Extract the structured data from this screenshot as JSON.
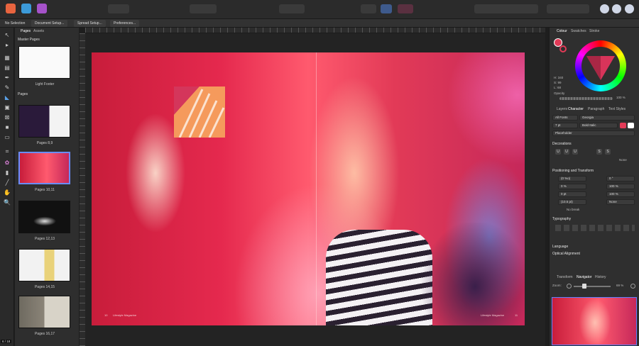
{
  "context_bar": {
    "items": [
      "No Selection",
      "Document Setup...",
      "Spread Setup...",
      "Preferences..."
    ]
  },
  "pages_panel": {
    "tabs": [
      "Pages",
      "Assets"
    ],
    "master_section": "Master Pages",
    "master_label": "Light Footer",
    "pages_section": "Pages",
    "spreads": [
      "Pages 8,9",
      "Pages 10,11",
      "Pages 12,13",
      "Pages 14,15",
      "Pages 16,17"
    ],
    "zoom_hint": "6 / 18"
  },
  "canvas": {
    "footer_left": "Lifestyle Magazine",
    "footer_left_num": "10",
    "footer_right": "Lifestyle Magazine",
    "footer_right_num": "11"
  },
  "right_panel": {
    "top_tabs": [
      "Colour",
      "Swatches",
      "Stroke"
    ],
    "hsl": {
      "h": "H: 340",
      "s": "S: 99",
      "l": "L: 68"
    },
    "opacity_label": "Opacity",
    "opacity_value": "100 %",
    "mid_tabs": [
      "Layers",
      "Character",
      "Paragraph",
      "Text Styles"
    ],
    "font_collection": "All Fonts",
    "font_family": "Georgia",
    "font_size": "7 pt",
    "font_style": "Bold Italic",
    "style_name": "Placeholder",
    "decorations_title": "Decorations",
    "decoration_buttons": [
      "U",
      "U",
      "U",
      "S",
      "S"
    ],
    "none_label": "None",
    "positioning_title": "Positioning and Transform",
    "pos_values": [
      "(0 %o)",
      "0 %",
      "0 pt",
      "(10.5 pt)"
    ],
    "pos_values_right": [
      "0 °",
      "100 %",
      "100 %",
      "None"
    ],
    "no_break": "No break",
    "typography_title": "Typography",
    "language_title": "Language",
    "optical_title": "Optical Alignment",
    "bottom_tabs": [
      "Transform",
      "Navigator",
      "History"
    ],
    "zoom_label": "Zoom:",
    "zoom_value": "69 %"
  },
  "colors": {
    "accent": "#e23a57",
    "logo": "#f59a5c",
    "panel": "#2f2f2f",
    "toolbar": "#2b2b2b"
  }
}
